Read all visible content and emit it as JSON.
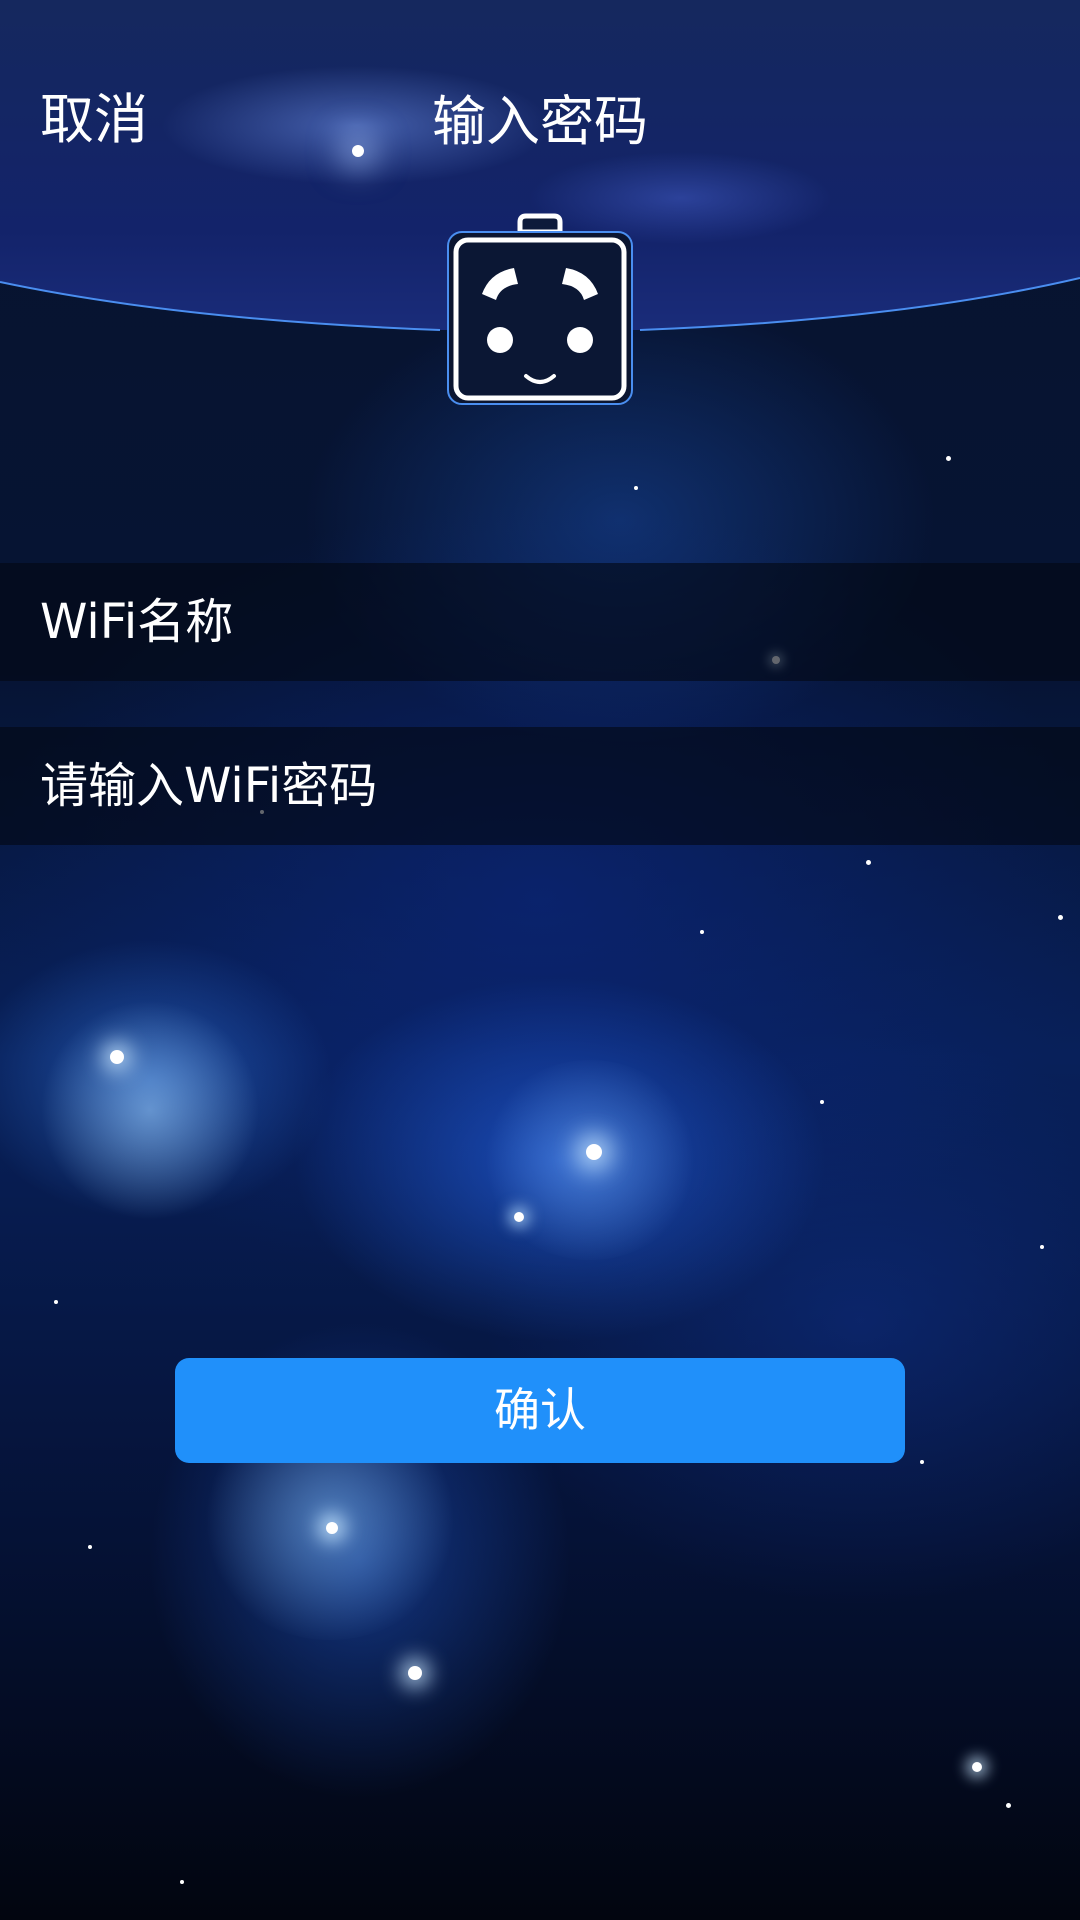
{
  "header": {
    "cancel_label": "取消",
    "title": "输入密码"
  },
  "form": {
    "wifi_name_label": "WiFi名称",
    "password_placeholder": "请输入WiFi密码",
    "password_value": ""
  },
  "actions": {
    "confirm_label": "确认"
  },
  "icons": {
    "mascot": "robot-face-icon"
  },
  "colors": {
    "accent": "#2090fa",
    "header_curve": "#4a8ef0",
    "text": "#ffffff"
  }
}
